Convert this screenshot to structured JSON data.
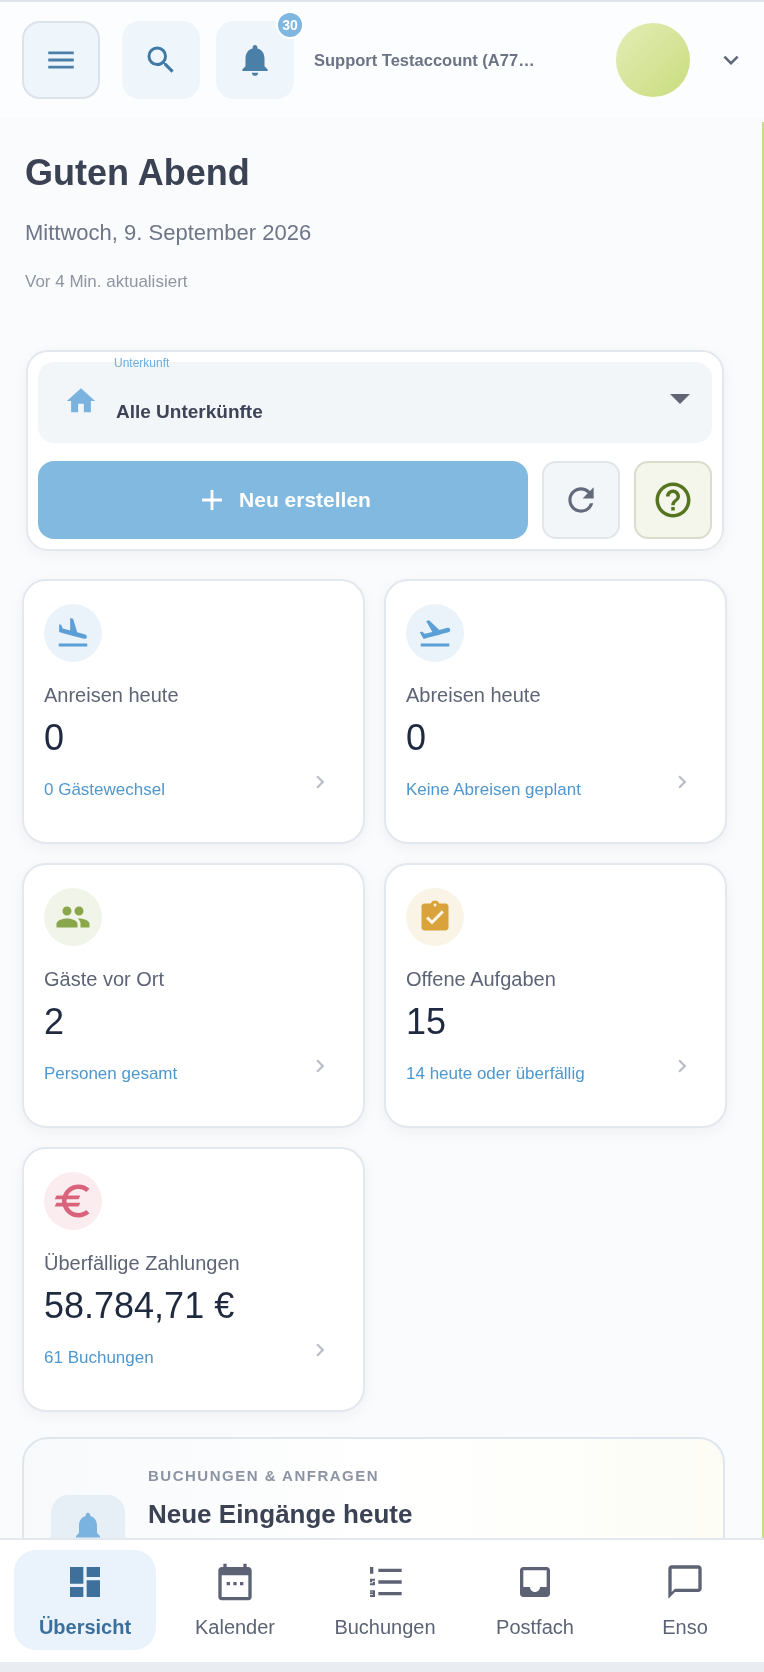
{
  "header": {
    "notification_count": "30",
    "account_name": "Support Testaccount (A77…"
  },
  "greeting": {
    "title": "Guten Abend",
    "date": "Mittwoch, 9. September 2026",
    "updated": "Vor 4 Min. aktualisiert"
  },
  "property_select": {
    "label": "Unterkunft",
    "value": "Alle Unterkünfte"
  },
  "create_button": {
    "label": "Neu erstellen"
  },
  "stats": [
    {
      "kind": "arrivals",
      "color": "#5b9fd6",
      "label": "Anreisen heute",
      "value": "0",
      "detail": "0 Gästewechsel"
    },
    {
      "kind": "departures",
      "color": "#5b9fd6",
      "label": "Abreisen heute",
      "value": "0",
      "detail": "Keine Abreisen geplant"
    },
    {
      "kind": "guests",
      "color": "#8aa64a",
      "label": "Gäste vor Ort",
      "value": "2",
      "detail": "Personen gesamt"
    },
    {
      "kind": "tasks",
      "color": "#d9a23a",
      "label": "Offene Aufgaben",
      "value": "15",
      "detail": "14 heute oder überfällig"
    },
    {
      "kind": "payments",
      "color": "#d9637a",
      "label": "Überfällige Zahlungen",
      "value": "58.784,71 €",
      "detail": "61 Buchungen"
    }
  ],
  "section": {
    "eyebrow": "BUCHUNGEN & ANFRAGEN",
    "title": "Neue Eingänge heute"
  },
  "nav": [
    {
      "kind": "overview",
      "label": "Übersicht",
      "selected": true
    },
    {
      "kind": "calendar",
      "label": "Kalender",
      "selected": false
    },
    {
      "kind": "bookings",
      "label": "Buchungen",
      "selected": false
    },
    {
      "kind": "inbox",
      "label": "Postfach",
      "selected": false
    },
    {
      "kind": "chat",
      "label": "Enso",
      "selected": false
    }
  ]
}
